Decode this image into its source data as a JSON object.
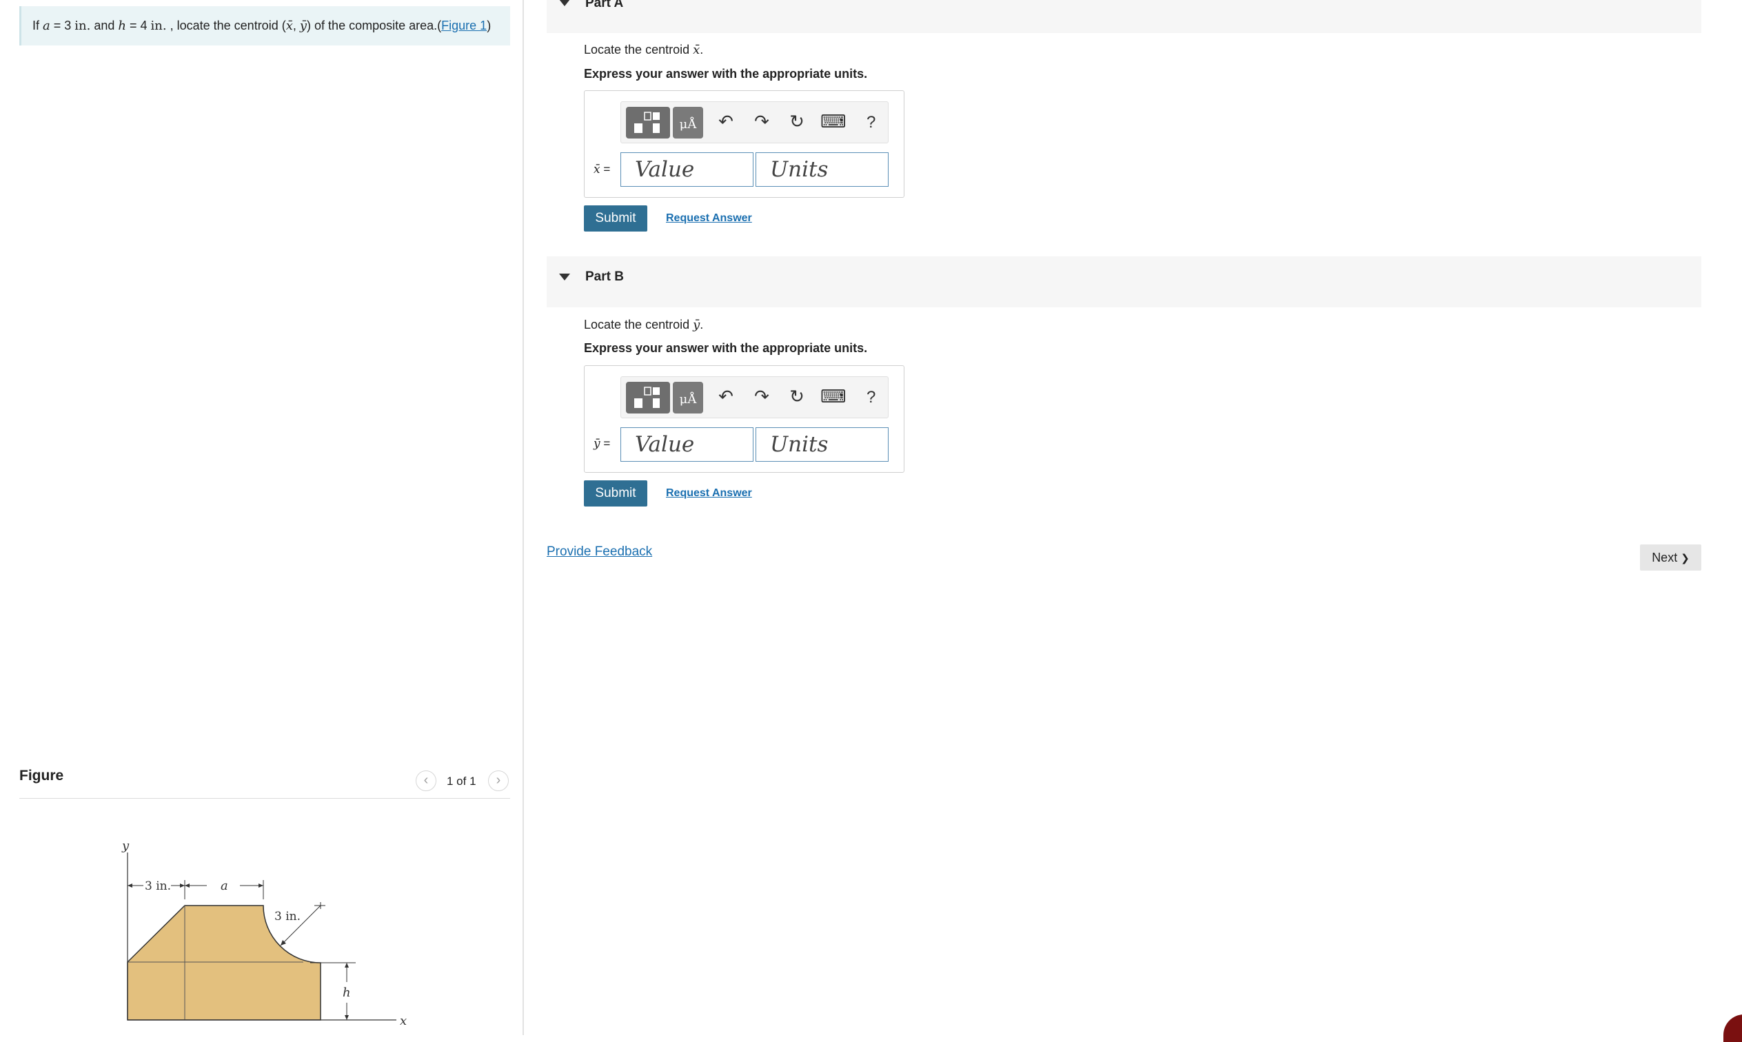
{
  "problem": {
    "prefix": "If ",
    "a_var": "a",
    "a_eq": " = 3 ",
    "a_unit": "in.",
    "and": " and ",
    "h_var": "h",
    "h_eq": " = 4 ",
    "h_unit": "in.",
    "mid": " , locate the centroid (",
    "xbar": "x̄",
    "comma": ", ",
    "ybar": "ȳ",
    "suffix": ") of the composite area.(",
    "figure_link": "Figure 1",
    "close": ")"
  },
  "figure": {
    "title": "Figure",
    "count": "1 of 1",
    "prev_glyph": "‹",
    "next_glyph": "›",
    "labels": {
      "y_axis": "y",
      "x_axis": "x",
      "dim_left": "3 in.",
      "dim_a": "a",
      "dim_radius": "3 in.",
      "dim_h": "h"
    }
  },
  "parts": [
    {
      "title": "Part A",
      "prompt_prefix": "Locate the centroid ",
      "symbol": "x̄",
      "prompt_suffix": ".",
      "instruction": "Express your answer with the appropriate units.",
      "var_label_sym": "x̄",
      "var_label_eq": " =",
      "value_placeholder": "Value",
      "units_placeholder": "Units",
      "submit": "Submit",
      "request": "Request Answer"
    },
    {
      "title": "Part B",
      "prompt_prefix": "Locate the centroid ",
      "symbol": "ȳ",
      "prompt_suffix": ".",
      "instruction": "Express your answer with the appropriate units.",
      "var_label_sym": "ȳ",
      "var_label_eq": " =",
      "value_placeholder": "Value",
      "units_placeholder": "Units",
      "submit": "Submit",
      "request": "Request Answer"
    }
  ],
  "toolbar": {
    "units_btn_text": "μÅ",
    "undo": "↶",
    "redo": "↷",
    "reset": "↻",
    "keyboard": "⌨",
    "help": "?"
  },
  "footer": {
    "feedback": "Provide Feedback",
    "next": "Next",
    "next_glyph": "❯"
  },
  "colors": {
    "accent": "#2f6f93",
    "link": "#1a6fb0",
    "shape_fill": "#e3c07e"
  }
}
